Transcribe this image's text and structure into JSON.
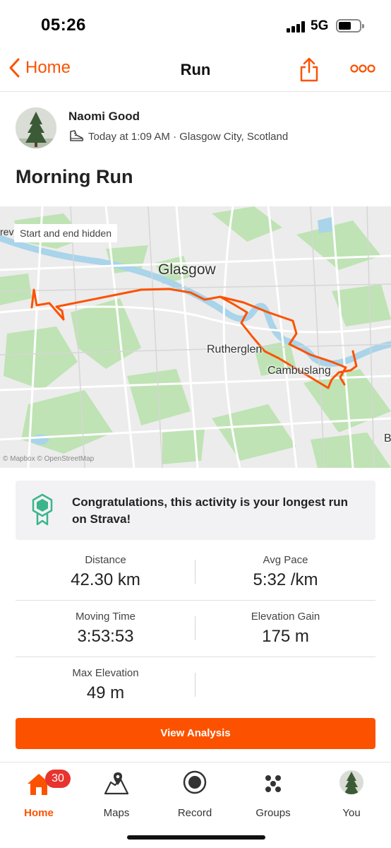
{
  "status_bar": {
    "time": "05:26",
    "network": "5G"
  },
  "nav": {
    "back_label": "Home",
    "title": "Run"
  },
  "athlete": {
    "name": "Naomi Good",
    "meta": "Today at 1:09 AM · Glasgow City, Scotland"
  },
  "activity": {
    "title": "Morning Run"
  },
  "map": {
    "privacy_chip": "Start and end hidden",
    "cut_label": "rev",
    "labels": {
      "city": "Glasgow",
      "town1": "Rutherglen",
      "town2": "Cambuslang",
      "edge": "B"
    },
    "attribution": "© Mapbox © OpenStreetMap",
    "route_color": "#fc5200"
  },
  "achievement": {
    "text": "Congratulations, this activity is your longest run on Strava!",
    "color": "#3bb58a"
  },
  "stats": {
    "distance": {
      "label": "Distance",
      "value": "42.30 km"
    },
    "avg_pace": {
      "label": "Avg Pace",
      "value": "5:32 /km"
    },
    "moving_time": {
      "label": "Moving Time",
      "value": "3:53:53"
    },
    "elevation_gain": {
      "label": "Elevation Gain",
      "value": "175 m"
    },
    "max_elevation": {
      "label": "Max Elevation",
      "value": "49 m"
    }
  },
  "analysis_button": "View Analysis",
  "tabbar": {
    "badge": "30",
    "tabs": {
      "home": "Home",
      "maps": "Maps",
      "record": "Record",
      "groups": "Groups",
      "you": "You"
    }
  },
  "colors": {
    "accent": "#fc5200",
    "badge": "#e8342f"
  }
}
